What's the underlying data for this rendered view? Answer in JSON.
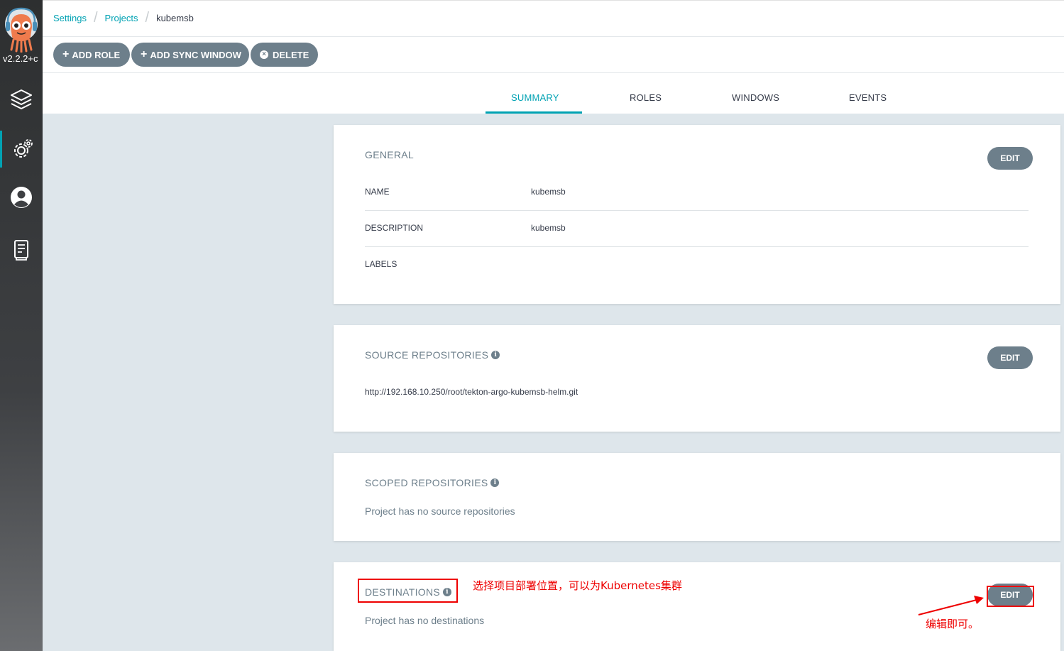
{
  "sidebar": {
    "version": "v2.2.2+c",
    "items": [
      {
        "icon": "layers-icon"
      },
      {
        "icon": "gear-icon",
        "active": true
      },
      {
        "icon": "user-icon"
      },
      {
        "icon": "docs-icon"
      }
    ]
  },
  "breadcrumb": {
    "settings": "Settings",
    "projects": "Projects",
    "current": "kubemsb"
  },
  "toolbar": {
    "add_role": "ADD ROLE",
    "add_sync_window": "ADD SYNC WINDOW",
    "delete": "DELETE"
  },
  "tabs": {
    "summary": "SUMMARY",
    "roles": "ROLES",
    "windows": "WINDOWS",
    "events": "EVENTS"
  },
  "general": {
    "title": "GENERAL",
    "edit": "EDIT",
    "name_label": "NAME",
    "name_value": "kubemsb",
    "description_label": "DESCRIPTION",
    "description_value": "kubemsb",
    "labels_label": "LABELS"
  },
  "source_repos": {
    "title": "SOURCE REPOSITORIES",
    "edit": "EDIT",
    "url": "http://192.168.10.250/root/tekton-argo-kubemsb-helm.git"
  },
  "scoped_repos": {
    "title": "SCOPED REPOSITORIES",
    "empty": "Project has no source repositories"
  },
  "destinations": {
    "title": "DESTINATIONS",
    "edit": "EDIT",
    "empty": "Project has no destinations"
  },
  "annotations": {
    "note1": "选择项目部署位置，可以为Kubernetes集群",
    "note2": "编辑即可。",
    "color": "#ee0000"
  },
  "colors": {
    "accent": "#00a2b3",
    "button": "#6d7f8b"
  }
}
